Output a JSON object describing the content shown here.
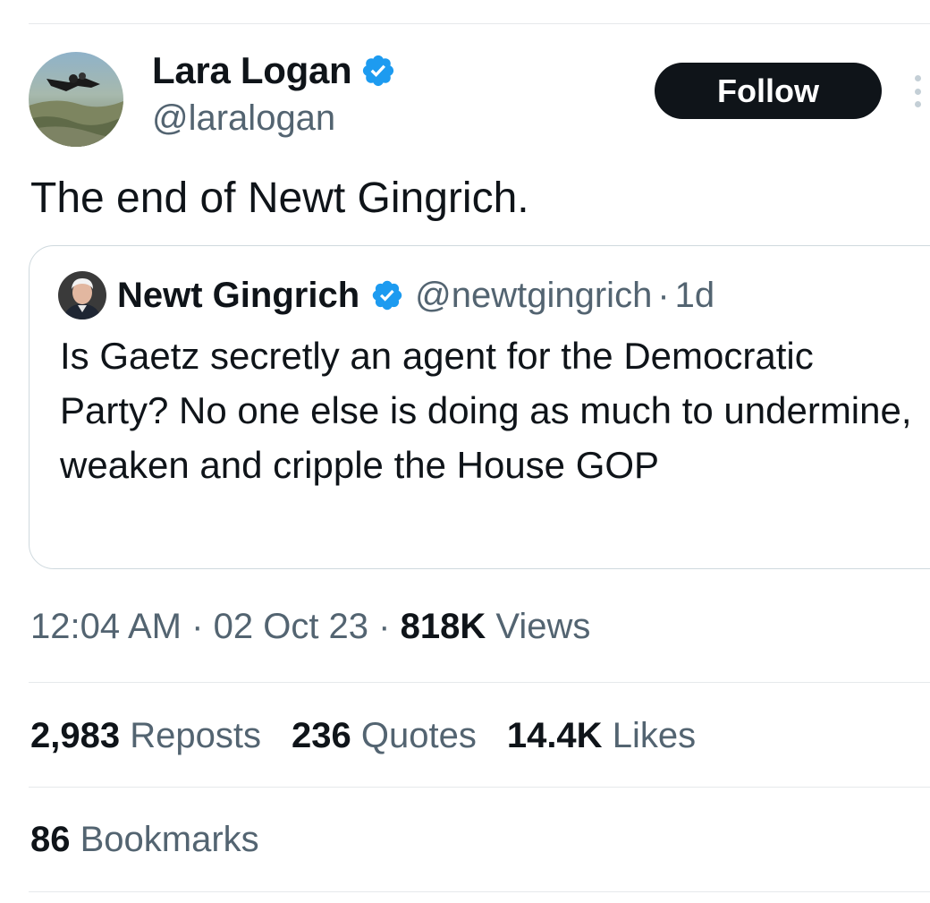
{
  "author": {
    "name": "Lara Logan",
    "handle": "@laralogan",
    "avatar_icon": "skydiver-avatar",
    "verified_color": "#1d9bf0"
  },
  "follow_label": "Follow",
  "more_icon": "more-options-icon",
  "tweet": {
    "text": "The end of Newt Gingrich."
  },
  "quote": {
    "name": "Newt Gingrich",
    "handle": "@newtgingrich",
    "separator": "·",
    "time": "1d",
    "text": "Is Gaetz secretly an agent for the Democratic Party? No one else is doing as much to undermine, weaken and cripple the House GOP"
  },
  "meta": {
    "time": "12:04 AM",
    "sep1": "·",
    "date": "02 Oct 23",
    "sep2": "·",
    "views_count": "818K",
    "views_label": "Views"
  },
  "stats": {
    "reposts_count": "2,983",
    "reposts_label": "Reposts",
    "quotes_count": "236",
    "quotes_label": "Quotes",
    "likes_count": "14.4K",
    "likes_label": "Likes",
    "bookmarks_count": "86",
    "bookmarks_label": "Bookmarks"
  },
  "colors": {
    "text": "#0f1419",
    "secondary": "#536471",
    "border": "#cfd9de",
    "verified": "#1d9bf0"
  }
}
